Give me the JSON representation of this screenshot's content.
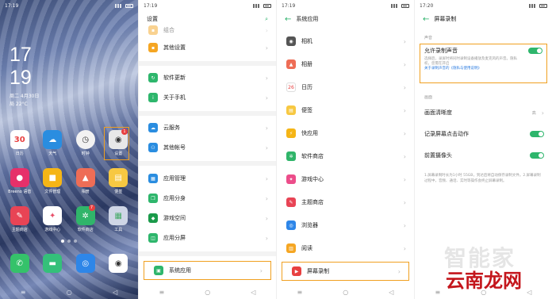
{
  "home": {
    "time_status": "17:19",
    "clock_hour": "17",
    "clock_min": "19",
    "date": "周二  4月30日",
    "weather": "局 22°C",
    "row1": [
      {
        "label": "日历",
        "icon": "calendar-icon",
        "glyph": "30",
        "color": "#ffffff"
      },
      {
        "label": "天气",
        "icon": "weather-icon",
        "glyph": "☁",
        "color": "#2a8de0"
      },
      {
        "label": "时钟",
        "icon": "clock-icon",
        "glyph": "🕐",
        "color": "#f2f2f2"
      },
      {
        "label": "设置",
        "icon": "settings-icon",
        "glyph": "◉",
        "color": "#e8e8e8"
      }
    ],
    "row2": [
      {
        "label": "Breeno 语音",
        "icon": "breeno-icon",
        "glyph": "●",
        "color": "#e6306a"
      },
      {
        "label": "文件管理",
        "icon": "folder-icon",
        "glyph": "■",
        "color": "#f5b516"
      },
      {
        "label": "相册",
        "icon": "photos-icon",
        "glyph": "▲",
        "color": "#ee6d56"
      },
      {
        "label": "便签",
        "icon": "notes-icon",
        "glyph": "▤",
        "color": "#f7c842"
      }
    ],
    "row3": [
      {
        "label": "主题商店",
        "icon": "theme-store-icon",
        "glyph": "✎",
        "color": "#e84455"
      },
      {
        "label": "游戏中心",
        "icon": "game-center-icon",
        "glyph": "✦",
        "color": "#ffffff"
      },
      {
        "label": "软件商店",
        "icon": "app-store-icon",
        "glyph": "✲",
        "color": "#30b56a"
      },
      {
        "label": "工具",
        "icon": "tools-folder-icon",
        "glyph": "▦",
        "color": "#cfd6e6"
      }
    ],
    "dock": [
      {
        "label": "",
        "icon": "phone-icon",
        "glyph": "✆",
        "color": "#35c26a"
      },
      {
        "label": "",
        "icon": "messages-icon",
        "glyph": "▬",
        "color": "#34c07a"
      },
      {
        "label": "",
        "icon": "browser-icon",
        "glyph": "◎",
        "color": "#2e86e8"
      },
      {
        "label": "",
        "icon": "camera-icon",
        "glyph": "◉",
        "color": "#ffffff"
      }
    ],
    "settings_badge": "1",
    "store_badge": "7"
  },
  "settings": {
    "time": "17:19",
    "title": "设置",
    "items": [
      {
        "label": "组合",
        "icon": "combo-icon",
        "color": "#f5a623"
      },
      {
        "label": "其他设置",
        "icon": "other-settings-icon",
        "color": "#f5a623"
      },
      {
        "label": "软件更新",
        "icon": "update-icon",
        "color": "#2eb66c"
      },
      {
        "label": "关于手机",
        "icon": "about-icon",
        "color": "#2eb66c"
      },
      {
        "label": "云服务",
        "icon": "cloud-icon",
        "color": "#2a8de0"
      },
      {
        "label": "其他帐号",
        "icon": "account-icon",
        "color": "#2a8de0"
      },
      {
        "label": "应用管理",
        "icon": "app-manage-icon",
        "color": "#2a8de0"
      },
      {
        "label": "应用分身",
        "icon": "app-clone-icon",
        "color": "#2eb66c"
      },
      {
        "label": "游戏空间",
        "icon": "game-space-icon",
        "color": "#1a9a4a"
      },
      {
        "label": "应用分屏",
        "icon": "split-screen-icon",
        "color": "#2eb66c"
      },
      {
        "label": "系统应用",
        "icon": "system-apps-icon",
        "color": "#2eb66c"
      }
    ]
  },
  "sysapps": {
    "time": "17:19",
    "title": "系统应用",
    "items": [
      {
        "label": "相机",
        "icon": "camera-icon",
        "color": "#555555"
      },
      {
        "label": "相册",
        "icon": "photos-icon",
        "color": "#ee6d56"
      },
      {
        "label": "日历",
        "icon": "calendar-icon",
        "color": "#ffffff"
      },
      {
        "label": "便签",
        "icon": "notes-icon",
        "color": "#f7c842"
      },
      {
        "label": "快应用",
        "icon": "quick-app-icon",
        "color": "#f5b516"
      },
      {
        "label": "软件商店",
        "icon": "app-store-icon",
        "color": "#30b56a"
      },
      {
        "label": "游戏中心",
        "icon": "game-center-icon",
        "color": "#ec4d8a"
      },
      {
        "label": "主题商店",
        "icon": "theme-store-icon",
        "color": "#e84455"
      },
      {
        "label": "浏览器",
        "icon": "browser-icon",
        "color": "#2e86e8"
      },
      {
        "label": "阅读",
        "icon": "reading-icon",
        "color": "#f5a623"
      },
      {
        "label": "屏幕录制",
        "icon": "screen-record-icon",
        "color": "#e84040"
      }
    ]
  },
  "record": {
    "time": "17:20",
    "title": "屏幕录制",
    "sound_section": "声音",
    "allow_sound": "允许录制声音",
    "allow_sound_desc": "选择后，录屏时将同时录制设备播放及麦克风的声音。隐私权，您需在开启",
    "allow_sound_link": "关于录制声音的《隐私与使用说明》",
    "screen_section": "画面",
    "quality": "画面清晰度",
    "quality_value": "高",
    "record_touch": "记录屏幕点击动作",
    "front_camera": "前置摄像头",
    "notes": "1.屏幕录制时长为1小时 55GB，到达后将自动保存录制文件。2.屏幕录制过程中，音频、通话、实时等操作会终止屏幕录制。"
  },
  "watermark": {
    "line1": "智能家",
    "line2": "云南龙网"
  }
}
